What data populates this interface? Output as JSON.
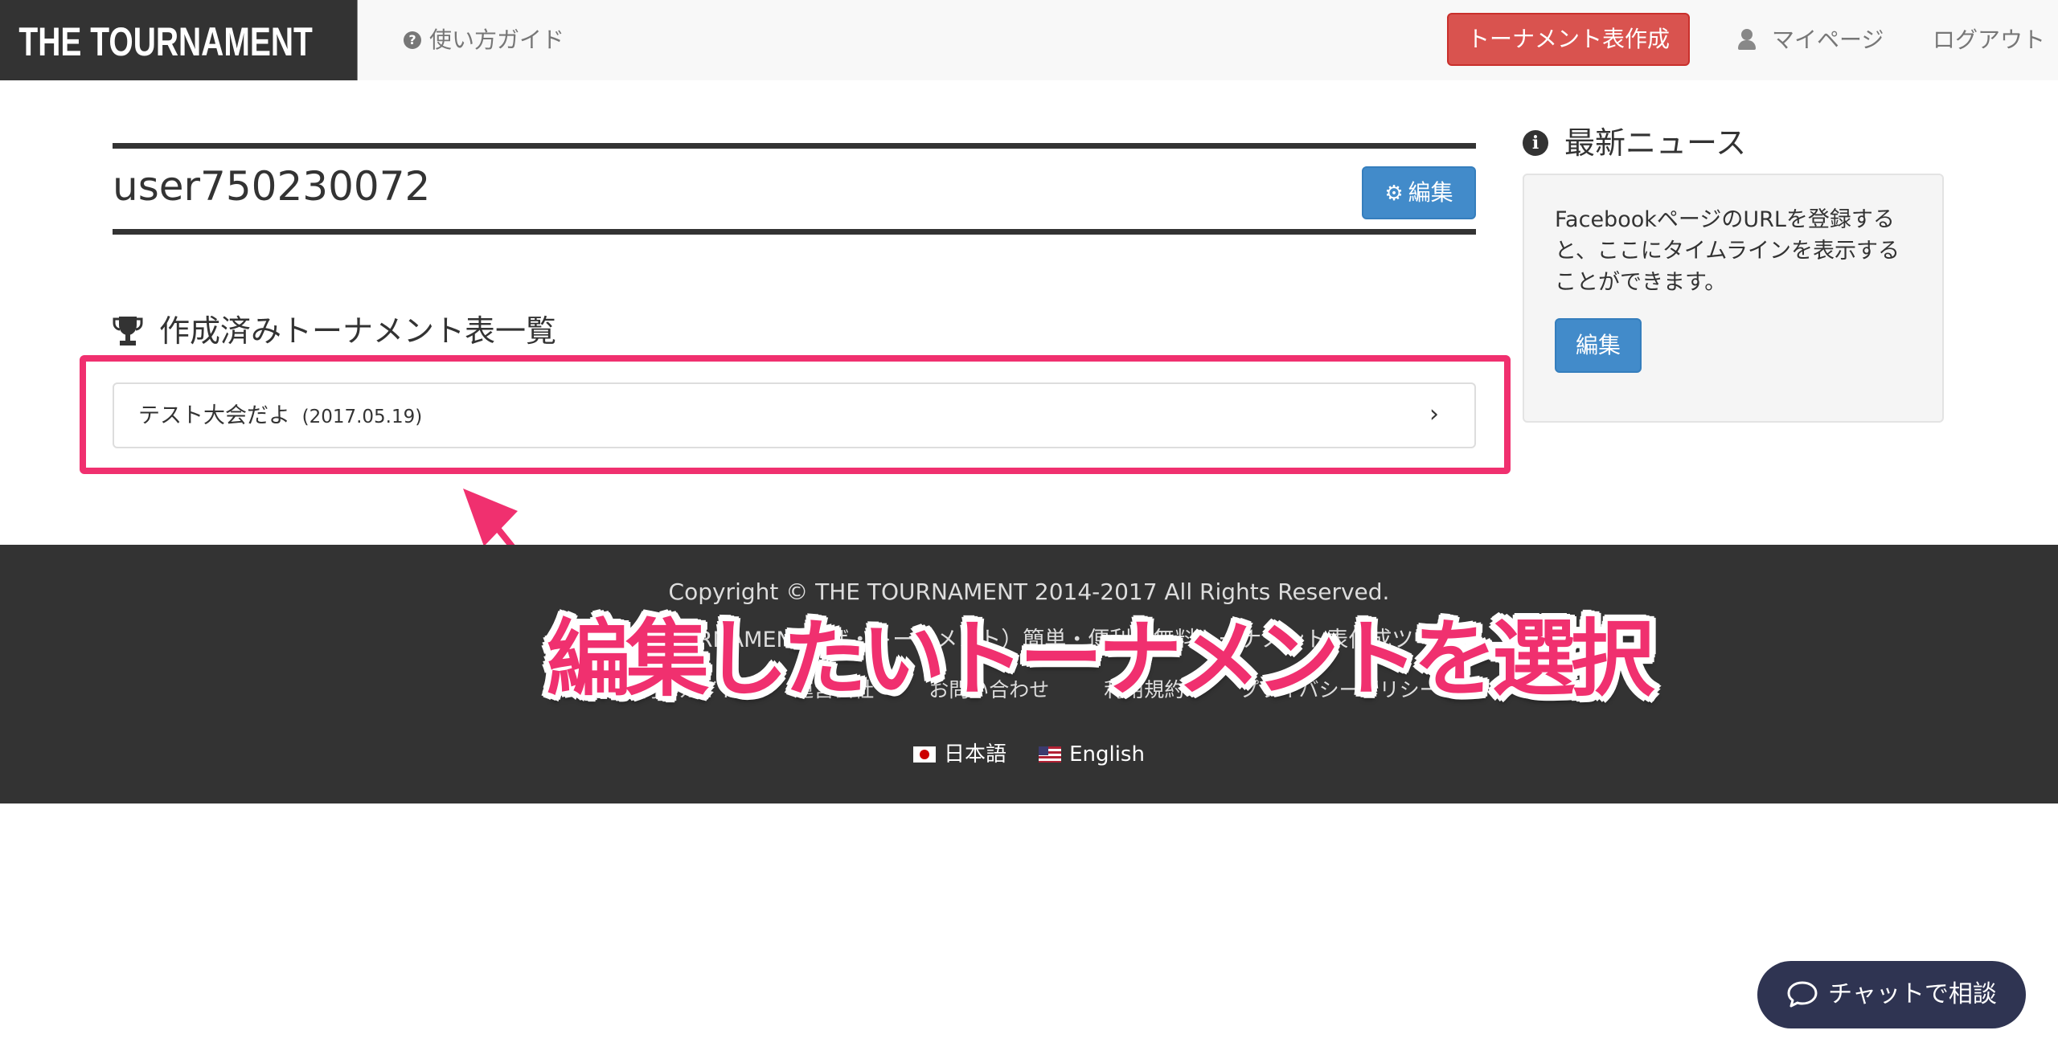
{
  "header": {
    "brand": "THE TOURNAMENT",
    "guide_label": "使い方ガイド",
    "create_label": "トーナメント表作成",
    "mypage_label": "マイページ",
    "logout_label": "ログアウト"
  },
  "profile": {
    "username": "user750230072",
    "edit_label": "編集"
  },
  "tournaments": {
    "heading": "作成済みトーナメント表一覧",
    "items": [
      {
        "name": "テスト大会だよ",
        "date": "(2017.05.19)"
      }
    ]
  },
  "news": {
    "heading": "最新ニュース",
    "text": "FacebookページのURLを登録すると、ここにタイムラインを表示することができます。",
    "edit_label": "編集"
  },
  "footer": {
    "copyright": "Copyright © THE TOURNAMENT 2014-2017 All Rights Reserved.",
    "tagline": "THE TOURNAMENT（ザ・トーナメント）簡単・便利な無料トーナメント表作成ツール",
    "links": [
      "ご利用ガイド",
      "運営会社",
      "お問い合わせ",
      "利用規約",
      "プライバシーポリシー"
    ],
    "languages": [
      {
        "label": "日本語",
        "flag": "jp-flag-icon"
      },
      {
        "label": "English",
        "flag": "us-flag-icon"
      }
    ]
  },
  "annotation": {
    "caption": "編集したいトーナメントを選択"
  },
  "chat": {
    "label": "チャットで相談"
  },
  "colors": {
    "brand_bg": "#333333",
    "create_button": "#d9534f",
    "edit_button": "#428bca",
    "highlight": "#f0306f",
    "chat_button": "#2f3452"
  }
}
